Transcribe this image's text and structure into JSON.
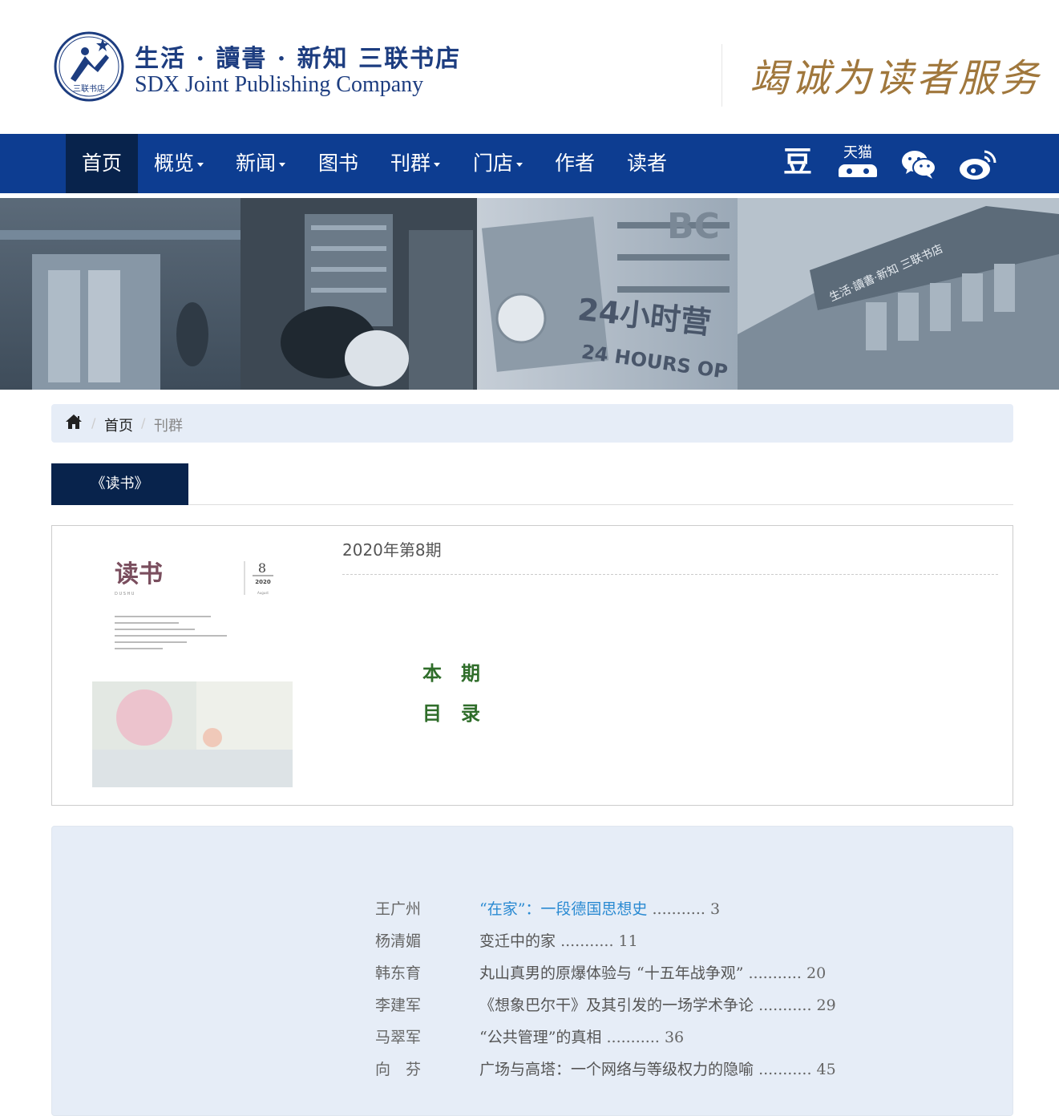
{
  "header": {
    "logo_text": "三联书店",
    "brand_cn": "生活 · 讀書 · 新知 三联书店",
    "brand_en": "SDX Joint Publishing Company",
    "slogan": "竭诚为读者服务"
  },
  "nav": {
    "items": [
      {
        "label": "首页",
        "dropdown": false,
        "active": true
      },
      {
        "label": "概览",
        "dropdown": true
      },
      {
        "label": "新闻",
        "dropdown": true
      },
      {
        "label": "图书",
        "dropdown": false
      },
      {
        "label": "刊群",
        "dropdown": true
      },
      {
        "label": "门店",
        "dropdown": true
      },
      {
        "label": "作者",
        "dropdown": false
      },
      {
        "label": "读者",
        "dropdown": false
      }
    ],
    "social": {
      "douban": "豆",
      "tmall": "天猫",
      "wechat_icon": "wechat-icon",
      "weibo_icon": "weibo-icon"
    }
  },
  "banner": {
    "text_24h": "24小时营",
    "text_hours": "24 HOURS OP",
    "text_bc": "BC",
    "sign_text": "生活·讀書·新知 三联书店"
  },
  "breadcrumb": {
    "home_icon": "home-icon",
    "items": [
      "首页",
      "刊群"
    ]
  },
  "tabs": {
    "active": "《读书》"
  },
  "issue": {
    "title": "2020年第8期",
    "cover": {
      "masthead": "读书",
      "pinyin": "D   U   S   H   U",
      "number": "8",
      "year": "2020",
      "month": "August"
    },
    "toc_heading_line1": "本期",
    "toc_heading_line2": "目录"
  },
  "contents": {
    "entries": [
      {
        "author": "王广州",
        "title": "“在家”：一段德国思想史",
        "dots": "...........",
        "page": "3",
        "link": true
      },
      {
        "author": "杨清媚",
        "title": "变迁中的家",
        "dots": "...........",
        "page": "11",
        "link": false
      },
      {
        "author": "韩东育",
        "title": "丸山真男的原爆体验与 “十五年战争观”",
        "dots": "...........",
        "page": "20",
        "link": false
      },
      {
        "author": "李建军",
        "title": "《想象巴尔干》及其引发的一场学术争论",
        "dots": "...........",
        "page": "29",
        "link": false
      },
      {
        "author": "马翠军",
        "title": "“公共管理”的真相",
        "dots": "...........",
        "page": "36",
        "link": false
      },
      {
        "author": "向　芬",
        "title": "广场与高塔：一个网络与等级权力的隐喻",
        "dots": "...........",
        "page": "45",
        "link": false
      }
    ]
  },
  "colors": {
    "nav_bg": "#0d3d91",
    "nav_active": "#08234c",
    "brand_blue": "#1d3d80",
    "slogan_gold": "#a0773c",
    "toc_green": "#2f6d2a",
    "link_blue": "#2a8ad2",
    "panel_bg": "#e6edf7"
  }
}
